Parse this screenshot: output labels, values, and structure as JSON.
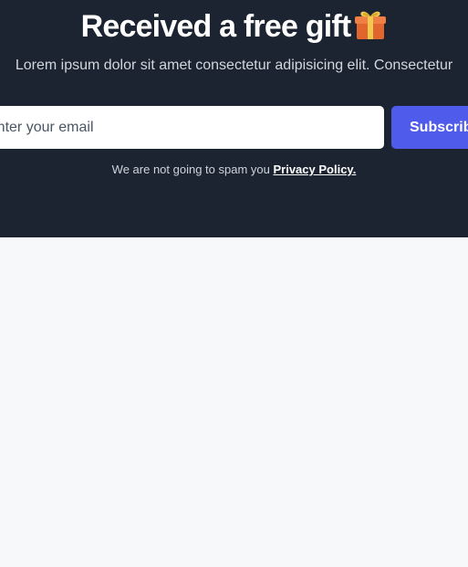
{
  "hero": {
    "title": "Received a free gift",
    "gift_icon": "gift-icon",
    "subtitle": "Lorem ipsum dolor sit amet consectetur adipisicing elit. Consectetur",
    "email_placeholder": "Enter your email",
    "subscribe_label": "Subscribe",
    "note_text": "We are not going to spam you ",
    "privacy_link": "Privacy Policy."
  },
  "colors": {
    "hero_background": "#1b2430",
    "page_background": "#f7f8fa",
    "button": "#4f5bea",
    "gift_box": "#e8743b",
    "gift_ribbon": "#f2c94c"
  }
}
